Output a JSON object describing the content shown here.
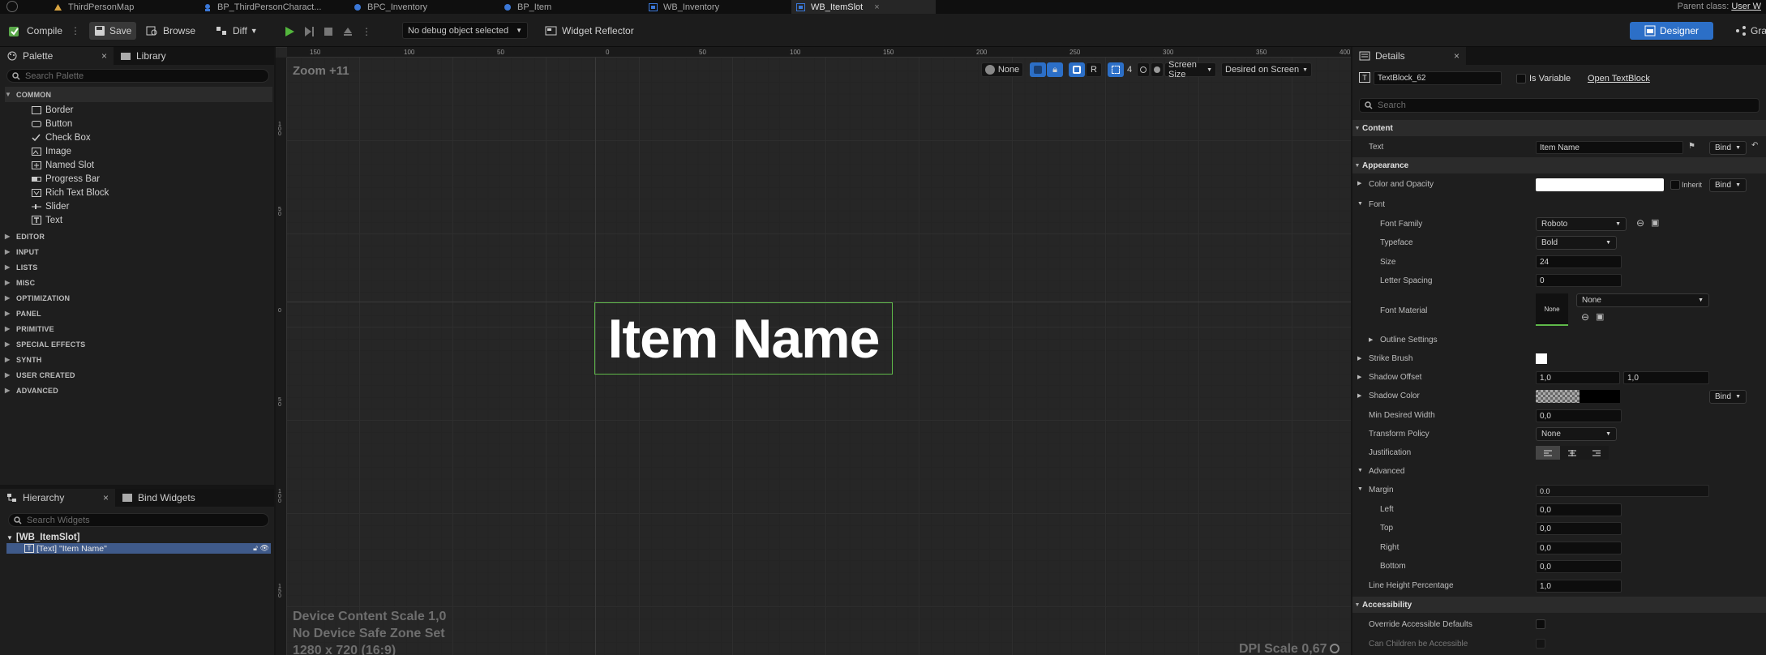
{
  "tabs": [
    {
      "label": "ThirdPersonMap",
      "icon": "level-icon"
    },
    {
      "label": "BP_ThirdPersonCharact...",
      "icon": "blueprint-icon"
    },
    {
      "label": "BPC_Inventory",
      "icon": "blueprint-icon"
    },
    {
      "label": "BP_Item",
      "icon": "blueprint-icon"
    },
    {
      "label": "WB_Inventory",
      "icon": "widget-icon"
    },
    {
      "label": "WB_ItemSlot",
      "icon": "widget-icon",
      "close": "×"
    }
  ],
  "parent_class": "Parent class:",
  "parent_class_value": "User W",
  "toolbar": {
    "compile": "Compile",
    "save": "Save",
    "browse": "Browse",
    "diff": "Diff",
    "debug": "No debug object selected",
    "widget_reflector": "Widget Reflector",
    "designer": "Designer",
    "graph": "Gra"
  },
  "palette": {
    "tab": "Palette",
    "library": "Library",
    "close": "×",
    "search_placeholder": "Search Palette",
    "common": "COMMON",
    "items": [
      "Border",
      "Button",
      "Check Box",
      "Image",
      "Named Slot",
      "Progress Bar",
      "Rich Text Block",
      "Slider",
      "Text"
    ],
    "categories": [
      "EDITOR",
      "INPUT",
      "LISTS",
      "MISC",
      "OPTIMIZATION",
      "PANEL",
      "PRIMITIVE",
      "SPECIAL EFFECTS",
      "SYNTH",
      "USER CREATED",
      "ADVANCED"
    ]
  },
  "hierarchy": {
    "tab": "Hierarchy",
    "bind_widgets": "Bind Widgets",
    "close": "×",
    "search_placeholder": "Search Widgets",
    "root": "[WB_ItemSlot]",
    "child": "[Text] \"Item Name\""
  },
  "viewport": {
    "zoom": "Zoom +11",
    "ruler_h": [
      "150",
      "100",
      "50",
      "0",
      "50",
      "100",
      "150",
      "200",
      "250",
      "300",
      "350",
      "400"
    ],
    "ruler_v": [
      "100",
      "50",
      "0",
      "50",
      "100",
      "150"
    ],
    "none_label": "None",
    "r_label": "R",
    "grid_num": "4",
    "screen_size": "Screen Size",
    "desired_on_screen": "Desired on Screen",
    "item_text": "Item Name",
    "device_scale": "Device Content Scale 1,0",
    "safe_zone": "No Device Safe Zone Set",
    "resolution": "1280 x 720 (16:9)",
    "dpi": "DPI Scale 0,67"
  },
  "details": {
    "tab": "Details",
    "close": "×",
    "widget_name": "TextBlock_62",
    "is_variable": "Is Variable",
    "open_textblock": "Open TextBlock",
    "search_placeholder": "Search",
    "content": "Content",
    "text_label": "Text",
    "text_value": "Item Name",
    "bind": "Bind",
    "appearance": "Appearance",
    "color_opacity": "Color and Opacity",
    "inherit": "Inherit",
    "font": "Font",
    "font_family": "Font Family",
    "font_family_value": "Roboto",
    "typeface": "Typeface",
    "typeface_value": "Bold",
    "size": "Size",
    "size_value": "24",
    "letter_spacing": "Letter Spacing",
    "letter_spacing_value": "0",
    "font_material": "Font Material",
    "font_material_thumb": "None",
    "font_material_value": "None",
    "outline_settings": "Outline Settings",
    "strike_brush": "Strike Brush",
    "shadow_offset": "Shadow Offset",
    "shadow_offset_x": "1,0",
    "shadow_offset_y": "1,0",
    "shadow_color": "Shadow Color",
    "min_desired_width": "Min Desired Width",
    "min_desired_width_value": "0,0",
    "transform_policy": "Transform Policy",
    "transform_policy_value": "None",
    "justification": "Justification",
    "advanced": "Advanced",
    "margin": "Margin",
    "margin_value": "0.0",
    "left": "Left",
    "left_value": "0,0",
    "top": "Top",
    "top_value": "0,0",
    "right": "Right",
    "right_value": "0,0",
    "bottom": "Bottom",
    "bottom_value": "0,0",
    "line_height": "Line Height Percentage",
    "line_height_value": "1,0",
    "accessibility": "Accessibility",
    "override_accessible": "Override Accessible Defaults",
    "children_accessible": "Can Children be Accessible"
  },
  "colors": {
    "accent": "#2c6fc7",
    "selection_outline": "#5fb94a",
    "play": "#53b63d"
  }
}
